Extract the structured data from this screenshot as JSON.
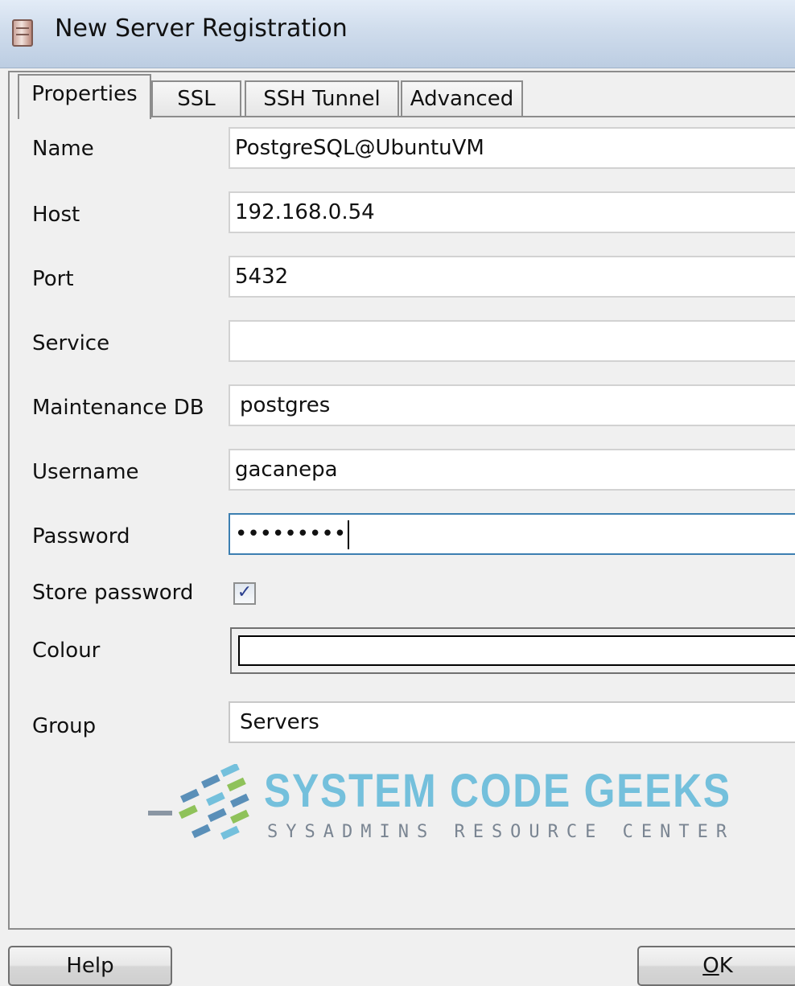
{
  "window": {
    "title": "New Server Registration"
  },
  "tabs": [
    {
      "label": "Properties"
    },
    {
      "label": "SSL"
    },
    {
      "label": "SSH Tunnel"
    },
    {
      "label": "Advanced"
    }
  ],
  "fields": {
    "name": {
      "label": "Name",
      "value": "PostgreSQL@UbuntuVM"
    },
    "host": {
      "label": "Host",
      "value": "192.168.0.54"
    },
    "port": {
      "label": "Port",
      "value": "5432"
    },
    "service": {
      "label": "Service",
      "value": ""
    },
    "maintenance_db": {
      "label": "Maintenance DB",
      "value": "postgres"
    },
    "username": {
      "label": "Username",
      "value": "gacanepa"
    },
    "password": {
      "label": "Password",
      "value": "•••••••••"
    },
    "store_password": {
      "label": "Store password",
      "checked": true,
      "mark": "✓"
    },
    "colour": {
      "label": "Colour",
      "value": ""
    },
    "group": {
      "label": "Group",
      "value": "Servers"
    }
  },
  "logo": {
    "main": "SYSTEM CODE GEEKS",
    "sub": "SYSADMINS RESOURCE CENTER"
  },
  "buttons": {
    "help": "Help",
    "ok_mnemonic": "O",
    "ok_rest": "K"
  },
  "colors": {
    "focus_border": "#3c7fb1",
    "logo_blue": "#74c0dc",
    "logo_green": "#8fc25a"
  }
}
